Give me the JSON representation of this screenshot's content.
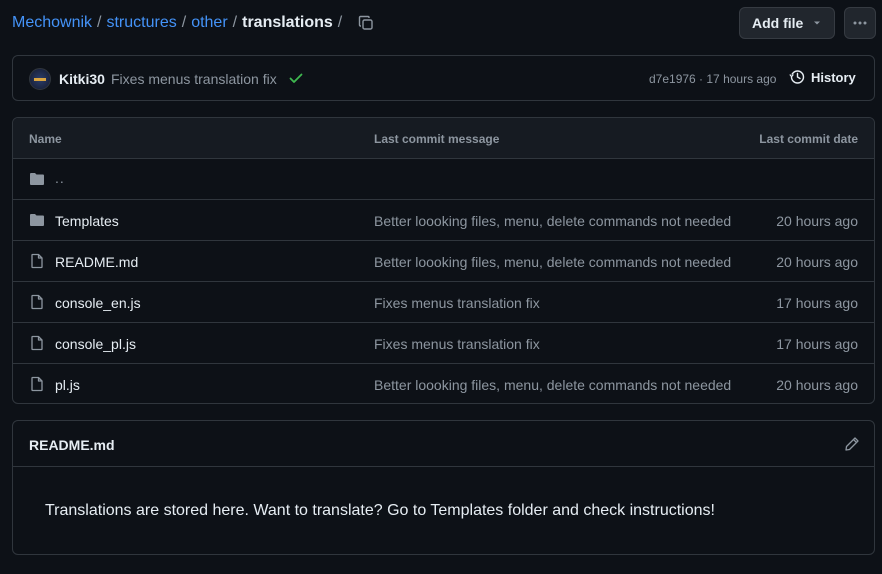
{
  "breadcrumb": {
    "items": [
      "Mechownik",
      "structures",
      "other"
    ],
    "current": "translations",
    "separator": "/"
  },
  "actions": {
    "add_file_label": "Add file"
  },
  "commit": {
    "author": "Kitki30",
    "message": "Fixes menus translation fix",
    "meta": "d7e1976 · 17 hours ago",
    "history_label": "History"
  },
  "table": {
    "headers": {
      "name": "Name",
      "message": "Last commit message",
      "date": "Last commit date"
    },
    "parent": "..",
    "rows": [
      {
        "type": "folder",
        "name": "Templates",
        "message": "Better loooking files, menu, delete commands not needed",
        "date": "20 hours ago"
      },
      {
        "type": "file",
        "name": "README.md",
        "message": "Better loooking files, menu, delete commands not needed",
        "date": "20 hours ago"
      },
      {
        "type": "file",
        "name": "console_en.js",
        "message": "Fixes menus translation fix",
        "date": "17 hours ago"
      },
      {
        "type": "file",
        "name": "console_pl.js",
        "message": "Fixes menus translation fix",
        "date": "17 hours ago"
      },
      {
        "type": "file",
        "name": "pl.js",
        "message": "Better loooking files, menu, delete commands not needed",
        "date": "20 hours ago"
      }
    ]
  },
  "readme": {
    "title": "README.md",
    "body": "Translations are stored here. Want to translate? Go to Templates folder and check instructions!"
  },
  "colors": {
    "background": "#0d1117",
    "link": "#4493f8",
    "muted": "#8d96a0",
    "border": "#30363d",
    "success": "#3fb950"
  }
}
